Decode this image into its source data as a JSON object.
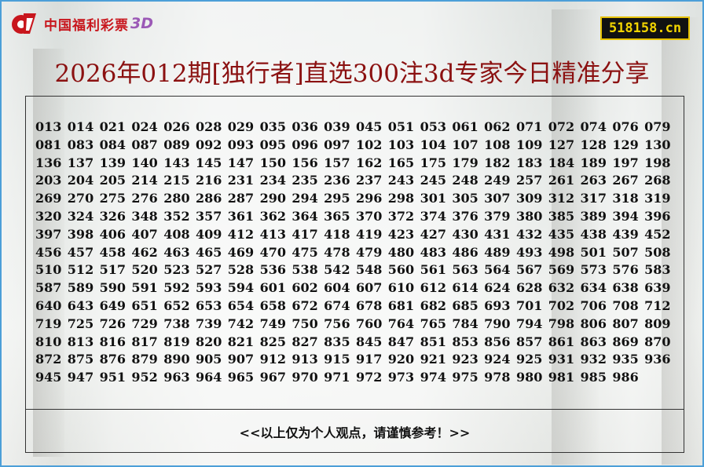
{
  "brand": {
    "logo_text": "中国福利彩票",
    "logo_suffix": "3D",
    "colors": {
      "red": "#c8161d",
      "suffix": "#9b59b6",
      "frame": "#4c9fd8"
    }
  },
  "site": {
    "label": "518158.cn"
  },
  "title": "2026年012期[独行者]直选300注3d专家今日精准分享",
  "numbers": [
    "013",
    "014",
    "021",
    "024",
    "026",
    "028",
    "029",
    "035",
    "036",
    "039",
    "045",
    "051",
    "053",
    "061",
    "062",
    "071",
    "072",
    "074",
    "076",
    "079",
    "081",
    "083",
    "084",
    "087",
    "089",
    "092",
    "093",
    "095",
    "096",
    "097",
    "102",
    "103",
    "104",
    "107",
    "108",
    "109",
    "127",
    "128",
    "129",
    "130",
    "136",
    "137",
    "139",
    "140",
    "143",
    "145",
    "147",
    "150",
    "156",
    "157",
    "162",
    "165",
    "175",
    "179",
    "182",
    "183",
    "184",
    "189",
    "197",
    "198",
    "203",
    "204",
    "205",
    "214",
    "215",
    "216",
    "231",
    "234",
    "235",
    "236",
    "237",
    "243",
    "245",
    "248",
    "249",
    "257",
    "261",
    "263",
    "267",
    "268",
    "269",
    "270",
    "275",
    "276",
    "280",
    "286",
    "287",
    "290",
    "294",
    "295",
    "296",
    "298",
    "301",
    "305",
    "307",
    "309",
    "312",
    "317",
    "318",
    "319",
    "320",
    "324",
    "326",
    "348",
    "352",
    "357",
    "361",
    "362",
    "364",
    "365",
    "370",
    "372",
    "374",
    "376",
    "379",
    "380",
    "385",
    "389",
    "394",
    "396",
    "397",
    "398",
    "406",
    "407",
    "408",
    "409",
    "412",
    "413",
    "417",
    "418",
    "419",
    "423",
    "427",
    "430",
    "431",
    "432",
    "435",
    "438",
    "439",
    "452",
    "456",
    "457",
    "458",
    "462",
    "463",
    "465",
    "469",
    "470",
    "475",
    "478",
    "479",
    "480",
    "483",
    "486",
    "489",
    "493",
    "498",
    "501",
    "507",
    "508",
    "510",
    "512",
    "517",
    "520",
    "523",
    "527",
    "528",
    "536",
    "538",
    "542",
    "548",
    "560",
    "561",
    "563",
    "564",
    "567",
    "569",
    "573",
    "576",
    "583",
    "587",
    "589",
    "590",
    "591",
    "592",
    "593",
    "594",
    "601",
    "602",
    "604",
    "607",
    "610",
    "612",
    "614",
    "624",
    "628",
    "632",
    "634",
    "638",
    "639",
    "640",
    "643",
    "649",
    "651",
    "652",
    "653",
    "654",
    "658",
    "672",
    "674",
    "678",
    "681",
    "682",
    "685",
    "693",
    "701",
    "702",
    "706",
    "708",
    "712",
    "719",
    "725",
    "726",
    "729",
    "738",
    "739",
    "742",
    "749",
    "750",
    "756",
    "760",
    "764",
    "765",
    "784",
    "790",
    "794",
    "798",
    "806",
    "807",
    "809",
    "810",
    "813",
    "816",
    "817",
    "819",
    "820",
    "821",
    "825",
    "827",
    "835",
    "845",
    "847",
    "851",
    "853",
    "856",
    "857",
    "861",
    "863",
    "869",
    "870",
    "872",
    "875",
    "876",
    "879",
    "890",
    "905",
    "907",
    "912",
    "913",
    "915",
    "917",
    "920",
    "921",
    "923",
    "924",
    "925",
    "931",
    "932",
    "935",
    "936",
    "945",
    "947",
    "951",
    "952",
    "963",
    "964",
    "965",
    "967",
    "970",
    "971",
    "972",
    "973",
    "974",
    "975",
    "978",
    "980",
    "981",
    "985",
    "986"
  ],
  "note": "<<以上仅为个人观点，请谨慎参考！>>"
}
